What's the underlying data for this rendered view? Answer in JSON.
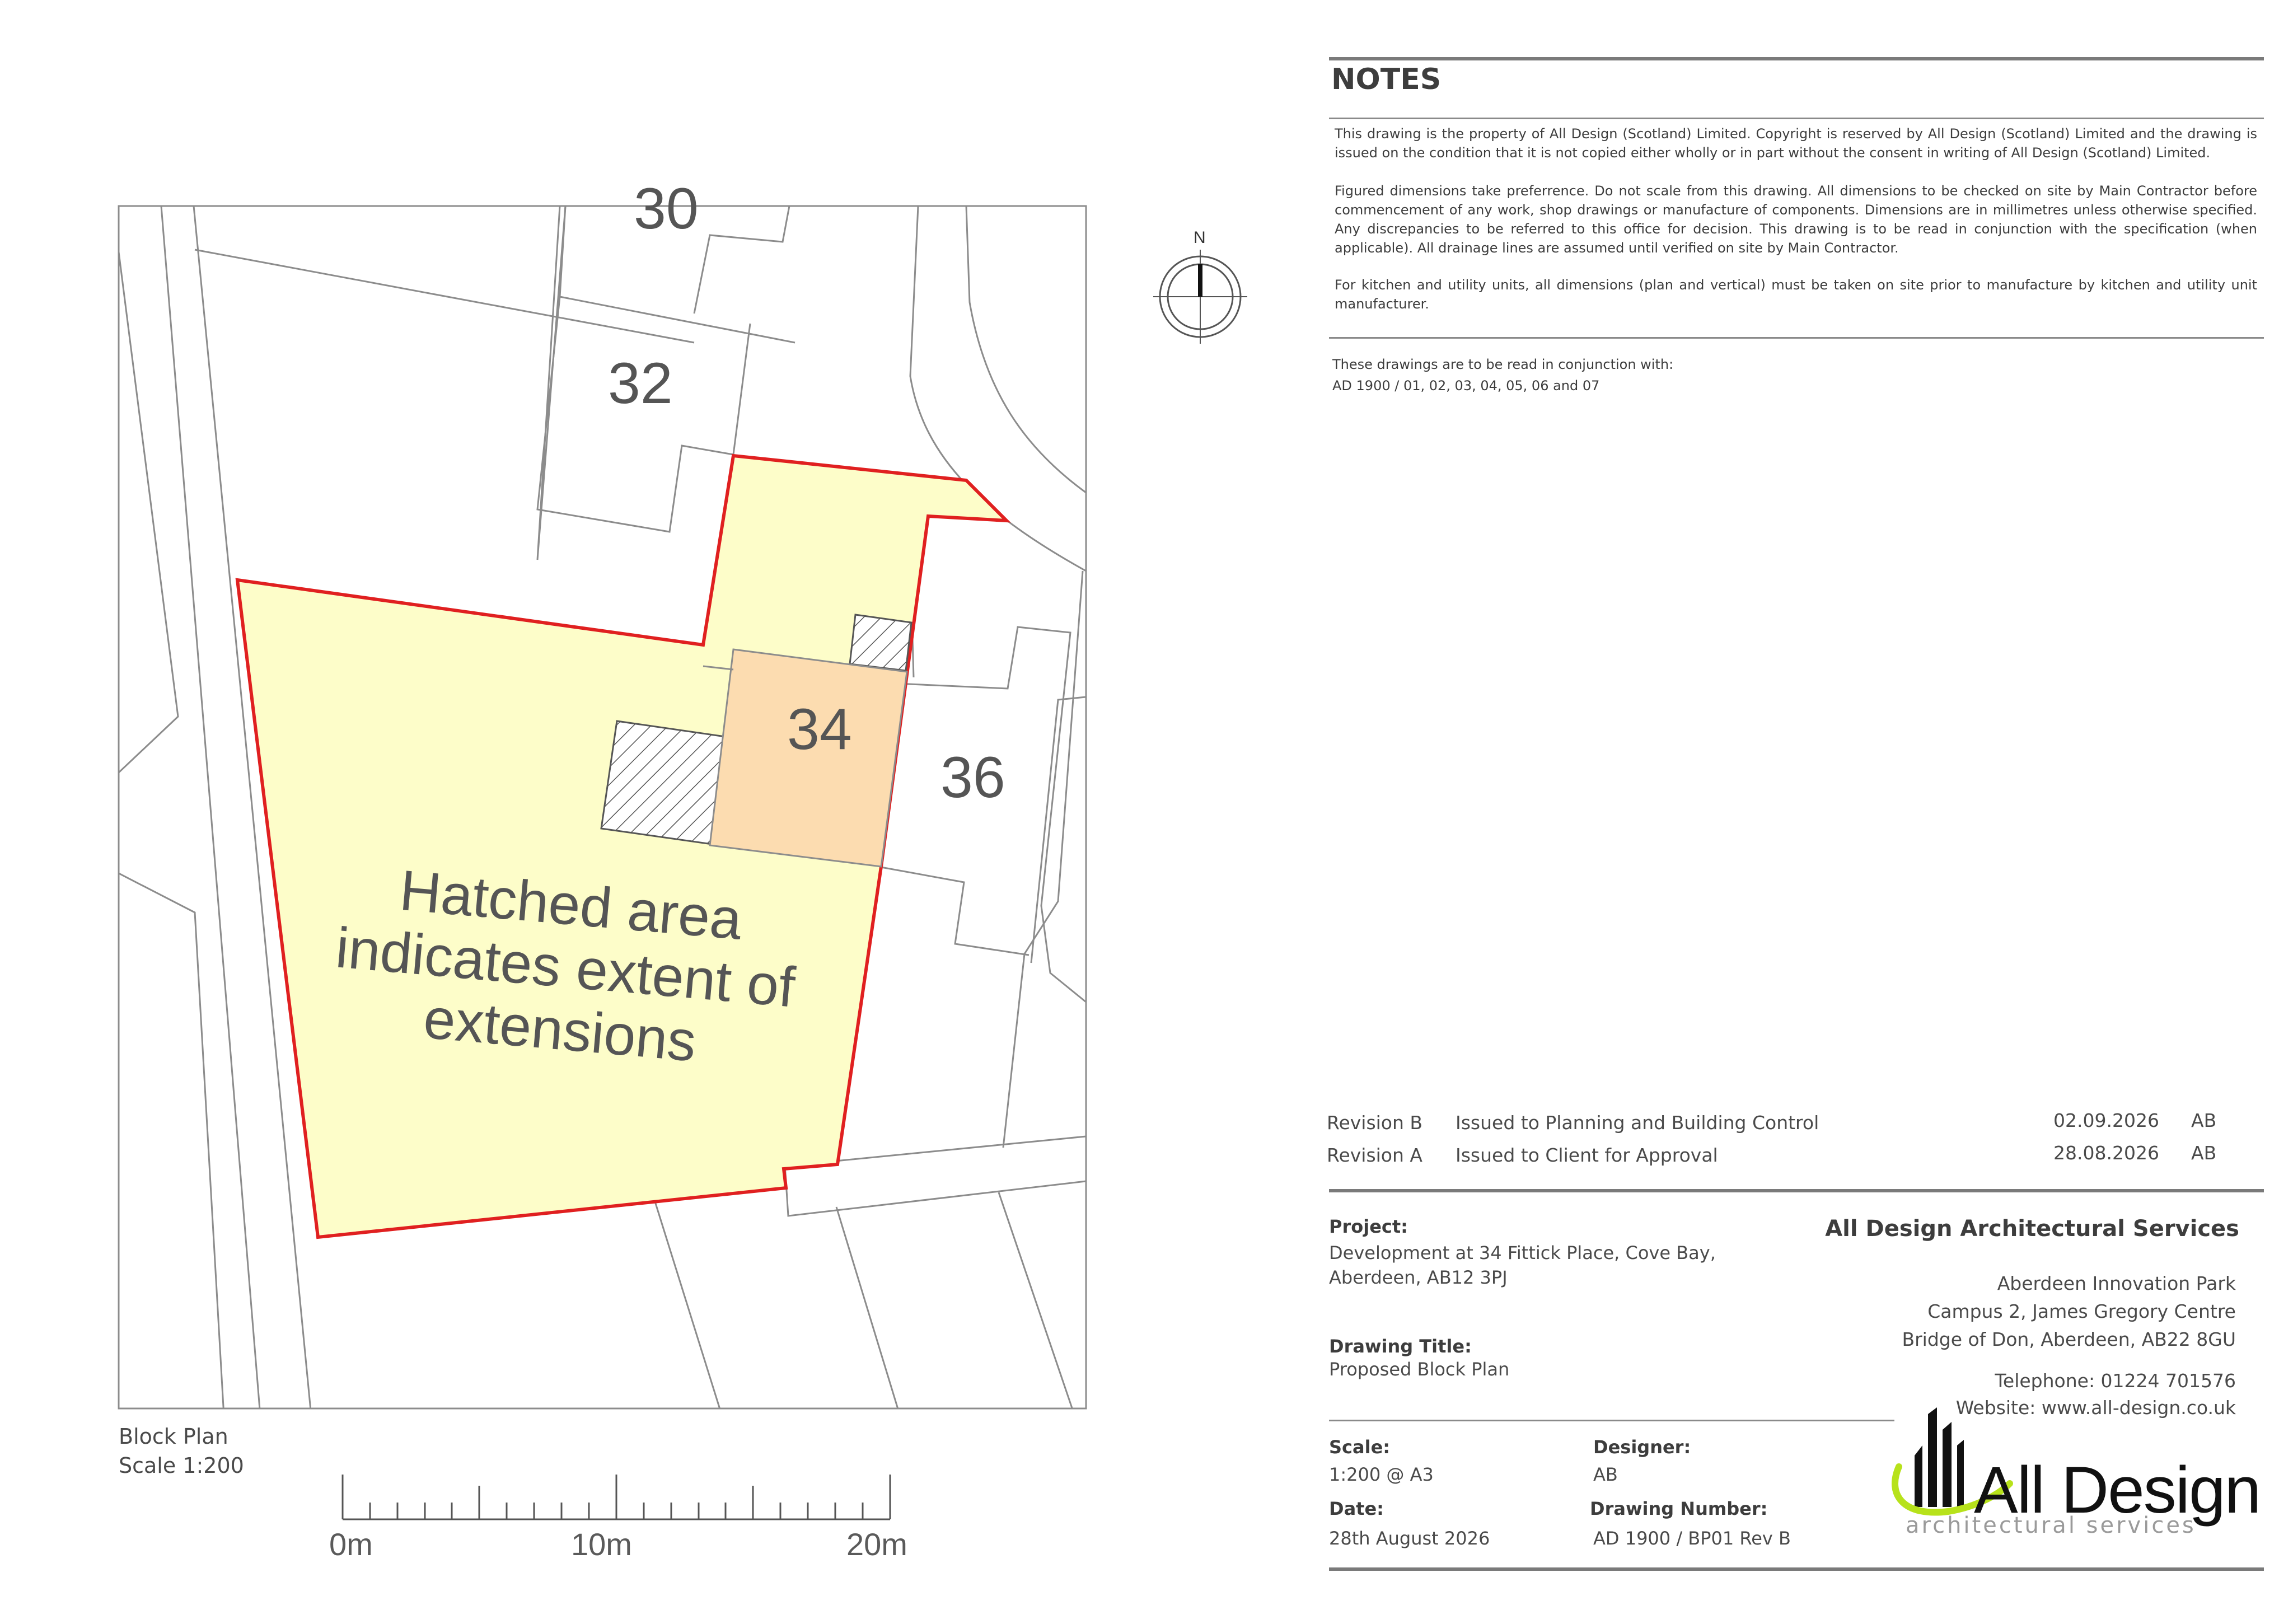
{
  "notes": {
    "title": "NOTES",
    "para1": "This drawing is the property of All Design (Scotland) Limited. Copyright is reserved by All Design (Scotland) Limited and the drawing is issued on the condition that it is not copied either wholly or in part without the consent in writing of All Design (Scotland) Limited.",
    "para2": "Figured dimensions take preferrence. Do not scale from this drawing. All dimensions to be checked on site by Main Contractor before commencement of any work, shop drawings or manufacture of components. Dimensions are in millimetres unless otherwise specified. Any discrepancies to be referred to this office for decision. This drawing is to be read in conjunction with the specification (when applicable). All drainage lines are assumed until verified on site by Main Contractor.",
    "para3": "For kitchen and utility units, all dimensions (plan and vertical) must be taken on site prior to manufacture by kitchen and utility unit manufacturer.",
    "conjunction_1": "These drawings are to be read in conjunction with:",
    "conjunction_2": "AD 1900 / 01, 02, 03, 04, 05, 06 and 07"
  },
  "revisions": [
    {
      "rev": "Revision B",
      "desc": "Issued to Planning and Building Control",
      "date": "02.09.2026",
      "by": "AB"
    },
    {
      "rev": "Revision A",
      "desc": "Issued to Client for Approval",
      "date": "28.08.2026",
      "by": "AB"
    }
  ],
  "project": {
    "label": "Project:",
    "line1": "Development at 34 Fittick Place, Cove Bay,",
    "line2": "Aberdeen, AB12 3PJ"
  },
  "drawing_title": {
    "label": "Drawing Title:",
    "value": "Proposed Block Plan"
  },
  "scale": {
    "label": "Scale:",
    "value": "1:200 @ A3"
  },
  "designer": {
    "label": "Designer:",
    "value": "AB"
  },
  "date": {
    "label": "Date:",
    "value": "28th August 2026"
  },
  "drawing_number": {
    "label": "Drawing Number:",
    "value": "AD 1900 / BP01 Rev B"
  },
  "company": {
    "name": "All Design Architectural Services",
    "addr1": "Aberdeen Innovation Park",
    "addr2": "Campus 2, James Gregory Centre",
    "addr3": "Bridge of Don, Aberdeen, AB22 8GU",
    "telephone": "Telephone:  01224 701576",
    "website": "Website: www.all-design.co.uk",
    "logo_main": "All Design",
    "logo_sub": "architectural services"
  },
  "plan": {
    "caption_1": "Block Plan",
    "caption_2": "Scale 1:200",
    "north": "N",
    "plot_numbers": [
      "30",
      "32",
      "34",
      "36"
    ],
    "annotation_1": "Hatched area",
    "annotation_2": "indicates extent of",
    "annotation_3": "extensions",
    "scale_ticks": [
      "0m",
      "10m",
      "20m"
    ],
    "colors": {
      "site_fill": "#fdfdc9",
      "house_fill": "#fcdcb0",
      "boundary": "#e02020",
      "lines": "#8c8c8c"
    }
  }
}
